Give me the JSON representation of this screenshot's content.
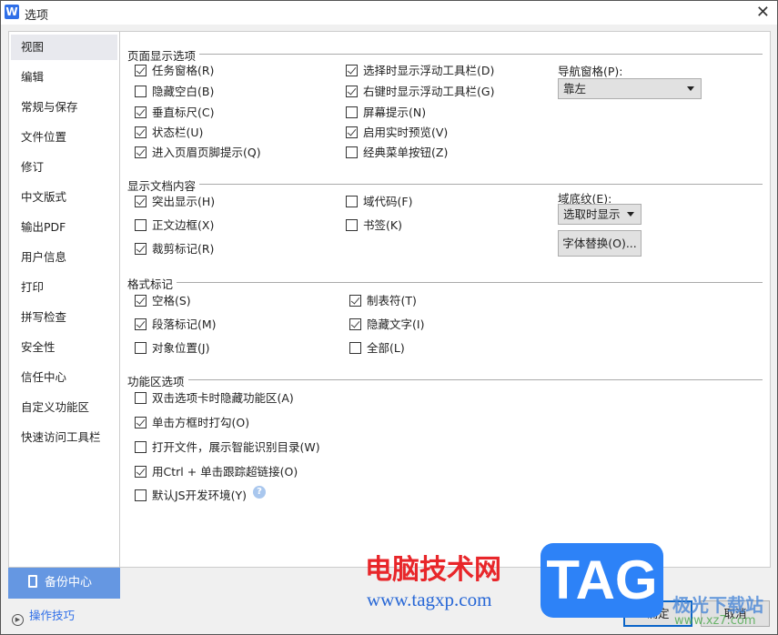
{
  "window": {
    "logo": "W",
    "title": "选项",
    "close": "✕"
  },
  "sidebar": {
    "items": [
      "视图",
      "编辑",
      "常规与保存",
      "文件位置",
      "修订",
      "中文版式",
      "输出PDF",
      "用户信息",
      "打印",
      "拼写检查",
      "安全性",
      "信任中心",
      "自定义功能区",
      "快速访问工具栏"
    ],
    "selected": 0,
    "backup_label": "备份中心",
    "tips_label": "操作技巧"
  },
  "sections": [
    {
      "title": "页面显示选项",
      "items": [
        {
          "label": "任务窗格(R)",
          "checked": true
        },
        {
          "label": "隐藏空白(B)",
          "checked": false
        },
        {
          "label": "垂直标尺(C)",
          "checked": true
        },
        {
          "label": "状态栏(U)",
          "checked": true
        },
        {
          "label": "进入页眉页脚提示(Q)",
          "checked": true
        },
        {
          "label": "选择时显示浮动工具栏(D)",
          "checked": true
        },
        {
          "label": "右键时显示浮动工具栏(G)",
          "checked": true
        },
        {
          "label": "屏幕提示(N)",
          "checked": false
        },
        {
          "label": "启用实时预览(V)",
          "checked": true
        },
        {
          "label": "经典菜单按钮(Z)",
          "checked": false
        }
      ]
    },
    {
      "title": "显示文档内容",
      "items": [
        {
          "label": "突出显示(H)",
          "checked": true
        },
        {
          "label": "正文边框(X)",
          "checked": false
        },
        {
          "label": "裁剪标记(R)",
          "checked": true
        },
        {
          "label": "域代码(F)",
          "checked": false
        },
        {
          "label": "书签(K)",
          "checked": false
        }
      ]
    },
    {
      "title": "格式标记",
      "items": [
        {
          "label": "空格(S)",
          "checked": true
        },
        {
          "label": "段落标记(M)",
          "checked": true
        },
        {
          "label": "对象位置(J)",
          "checked": false
        },
        {
          "label": "制表符(T)",
          "checked": true
        },
        {
          "label": "隐藏文字(I)",
          "checked": true
        },
        {
          "label": "全部(L)",
          "checked": false
        }
      ]
    },
    {
      "title": "功能区选项",
      "items": [
        {
          "label": "双击选项卡时隐藏功能区(A)",
          "checked": false
        },
        {
          "label": "单击方框时打勾(O)",
          "checked": true
        },
        {
          "label": "打开文件，展示智能识别目录(W)",
          "checked": false
        },
        {
          "label": "用Ctrl + 单击跟踪超链接(O)",
          "checked": true
        },
        {
          "label": "默认JS开发环境(Y)",
          "checked": false
        }
      ]
    }
  ],
  "nav_pane": {
    "label": "导航窗格(P):",
    "value": "靠左"
  },
  "field_shading": {
    "label": "域底纹(E):",
    "value": "选取时显示"
  },
  "font_sub_button": "字体替换(O)...",
  "help_icon": "?",
  "footer": {
    "ok": "确定",
    "cancel": "取消"
  },
  "watermark": {
    "text1": "电脑技术网",
    "text2": "www.tagxp.com",
    "logo": "TAG",
    "text3": "极光下载站",
    "text4": "www.xz7.com"
  }
}
